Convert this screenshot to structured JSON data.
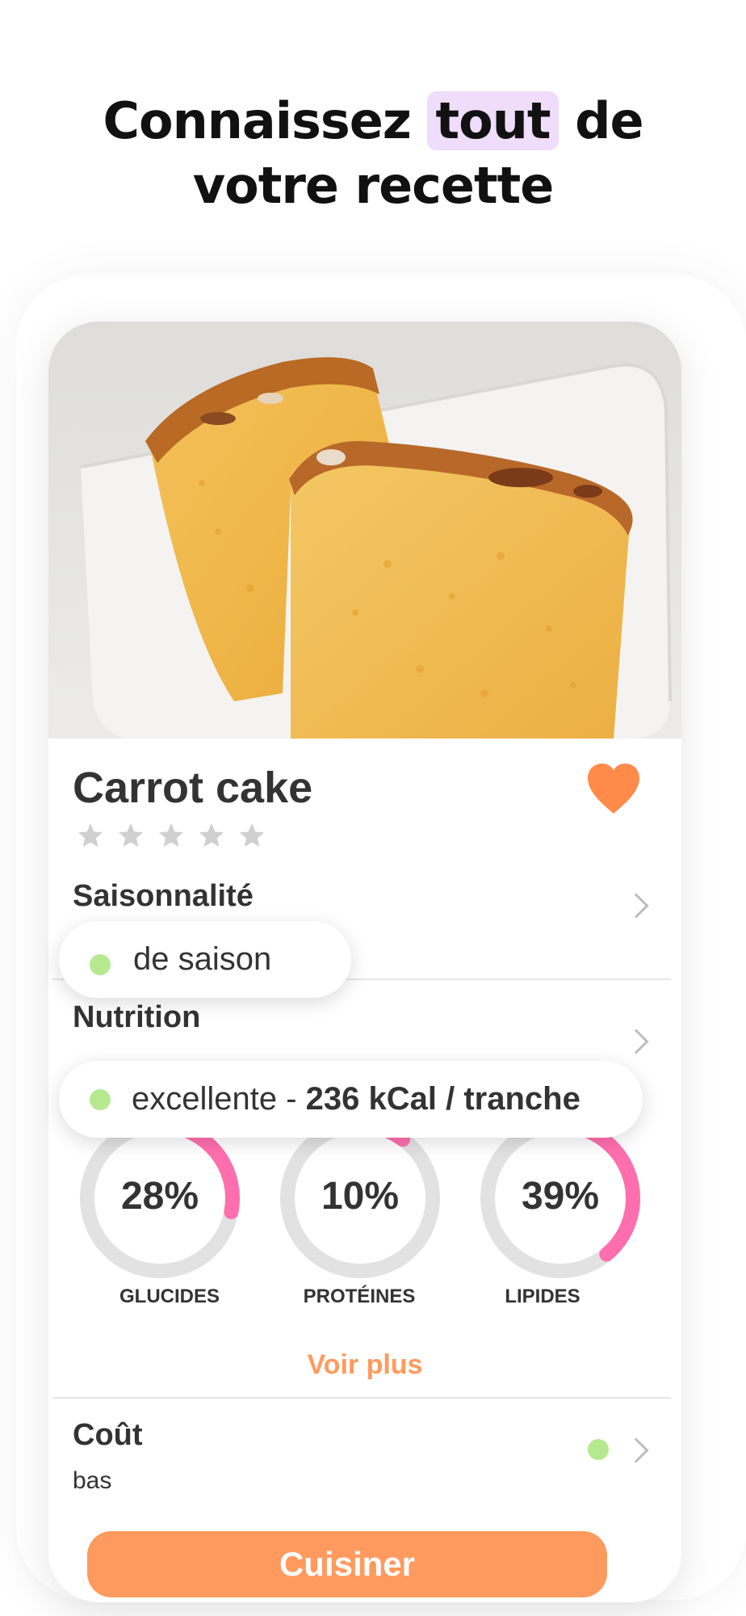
{
  "headline": {
    "before": "Connaissez ",
    "highlight": "tout",
    "after": " de",
    "line2": "votre recette"
  },
  "recipe": {
    "title": "Carrot cake",
    "favorite": true,
    "rating_filled": 0,
    "rating_max": 5
  },
  "seasonality": {
    "label": "Saisonnalité",
    "status": "de saison"
  },
  "nutrition": {
    "label": "Nutrition",
    "quality": "excellente - ",
    "energy": "236 kCal / tranche",
    "macros": [
      {
        "name": "GLUCIDES",
        "percent_label": "28%",
        "value": 28
      },
      {
        "name": "PROTÉINES",
        "percent_label": "10%",
        "value": 10
      },
      {
        "name": "LIPIDES",
        "percent_label": "39%",
        "value": 39
      }
    ],
    "see_more": "Voir plus"
  },
  "cost": {
    "label": "Coût",
    "value": "bas"
  },
  "cta": {
    "label": "Cuisiner"
  },
  "colors": {
    "accent": "#ff9a5e",
    "heart": "#ff8a4a",
    "status_green": "#b6e890",
    "ring_pink": "#ff6fae",
    "ring_track": "#e2e2e2",
    "highlight": "#f0dcfb"
  }
}
